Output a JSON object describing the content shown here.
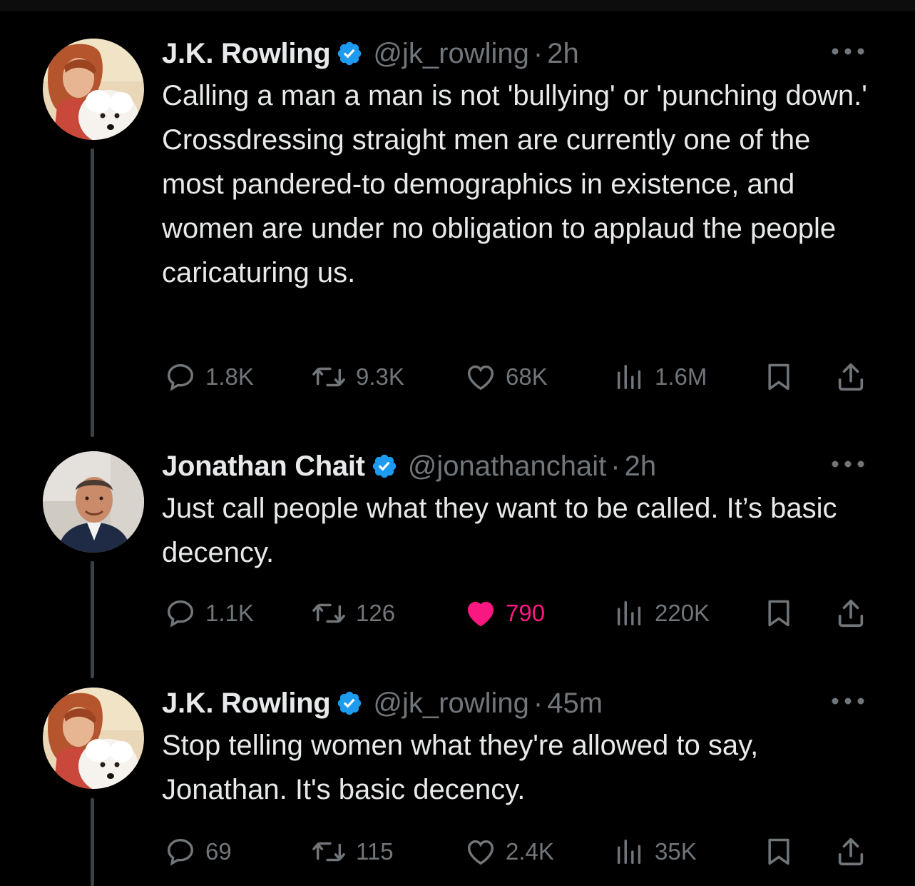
{
  "colors": {
    "background": "#000000",
    "text_primary": "#e7e9ea",
    "text_secondary": "#71767b",
    "verified_blue": "#1d9bf0",
    "like_pink": "#f91880",
    "thread_line": "#3b4045"
  },
  "tweets": [
    {
      "display_name": "J.K. Rowling",
      "handle": "@jk_rowling",
      "separator": "·",
      "time": "2h",
      "verified": true,
      "avatar_icon": "avatar-woman-with-dog",
      "text": "Calling a man a man is not 'bullying' or 'punching down.' Crossdressing straight men are currently one of the most pandered-to demographics in existence, and women are under no obligation to applaud the people caricaturing us.",
      "replies": "1.8K",
      "reposts": "9.3K",
      "likes": "68K",
      "liked": false,
      "views": "1.6M"
    },
    {
      "display_name": "Jonathan Chait",
      "handle": "@jonathanchait",
      "separator": "·",
      "time": "2h",
      "verified": true,
      "avatar_icon": "avatar-man-in-suit",
      "text": "Just call people what they want to be called. It’s basic decency.",
      "replies": "1.1K",
      "reposts": "126",
      "likes": "790",
      "liked": true,
      "views": "220K"
    },
    {
      "display_name": "J.K. Rowling",
      "handle": "@jk_rowling",
      "separator": "·",
      "time": "45m",
      "verified": true,
      "avatar_icon": "avatar-woman-with-dog",
      "text": "Stop telling women what they're allowed to say, Jonathan. It's basic decency.",
      "replies": "69",
      "reposts": "115",
      "likes": "2.4K",
      "liked": false,
      "views": "35K"
    }
  ],
  "icons": {
    "reply": "reply-icon",
    "repost": "repost-icon",
    "like": "heart-icon",
    "views": "views-icon",
    "bookmark": "bookmark-icon",
    "share": "share-icon",
    "more": "more-icon",
    "verified": "verified-badge-icon"
  }
}
